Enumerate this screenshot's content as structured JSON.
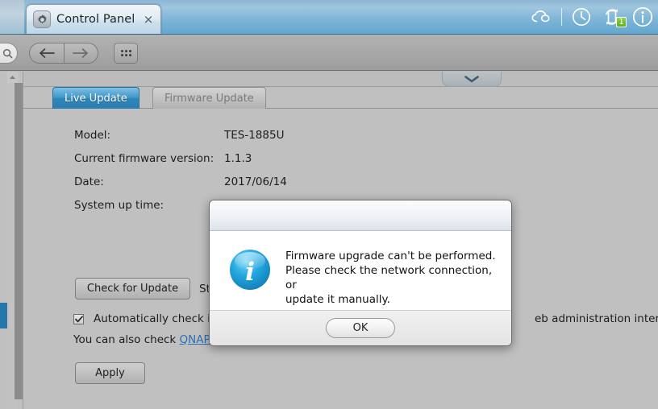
{
  "window": {
    "tab": {
      "title": "Control Panel",
      "icon": "gear-icon",
      "close_label": "×"
    },
    "tray": [
      {
        "name": "cloud-icon"
      },
      {
        "name": "clock-icon"
      },
      {
        "name": "sync-icon",
        "badge": "1",
        "badge_color": "#6ec21d"
      },
      {
        "name": "info-icon"
      }
    ]
  },
  "navbar": {
    "back_label": "←",
    "forward_label": "→",
    "apps_label": "apps-grid-icon",
    "search_label": "search-icon"
  },
  "content": {
    "collapse_label": "chevron-down-icon",
    "tabs": [
      {
        "label": "Live Update",
        "active": true
      },
      {
        "label": "Firmware Update",
        "active": false
      }
    ],
    "info_rows": [
      {
        "label": "Model:",
        "value": "TES-1885U"
      },
      {
        "label": "Current firmware version:",
        "value": "1.1.3"
      },
      {
        "label": "Date:",
        "value": "2017/06/14"
      },
      {
        "label": "System up time:",
        "value": ""
      }
    ],
    "check_update_label": "Check for Update",
    "status_text": "St",
    "auto_check_label": "Automatically check if",
    "auto_check_label_tail": "eb administration interface.",
    "auto_check_checked": true,
    "also_check_prefix": "You can also check ",
    "also_check_link": "QNAP",
    "apply_label": "Apply"
  },
  "dialog": {
    "title": "",
    "icon": "info-icon",
    "message": "Firmware upgrade can't be performed.\nPlease check the network connection, or\nupdate it manually.",
    "ok_label": "OK"
  },
  "colors": {
    "accent_blue": "#2a7fb4",
    "selected_rail": "#2576ad",
    "link": "#2a6fb5",
    "badge_green": "#6ec21d"
  }
}
